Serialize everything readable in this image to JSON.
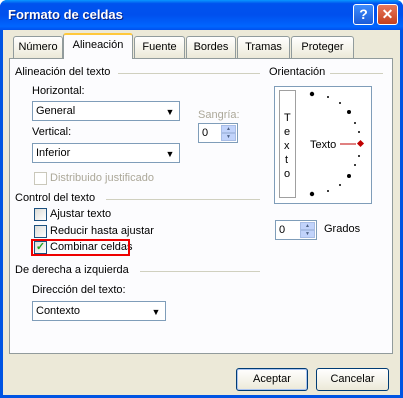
{
  "window": {
    "title": "Formato de celdas",
    "help_glyph": "?",
    "close_glyph": "✕"
  },
  "tabs": [
    {
      "label": "Número"
    },
    {
      "label": "Alineación",
      "active": true
    },
    {
      "label": "Fuente"
    },
    {
      "label": "Bordes"
    },
    {
      "label": "Tramas"
    },
    {
      "label": "Proteger"
    }
  ],
  "alignment": {
    "section_title": "Alineación del texto",
    "horizontal": {
      "label": "Horizontal:",
      "value": "General"
    },
    "vertical": {
      "label": "Vertical:",
      "value": "Inferior"
    },
    "indent": {
      "label": "Sangría:",
      "value": "0"
    },
    "distributed": {
      "label": "Distribuido justificado",
      "checked": false
    }
  },
  "text_control": {
    "section_title": "Control del texto",
    "wrap": {
      "label": "Ajustar texto",
      "checked": false
    },
    "shrink": {
      "label": "Reducir hasta ajustar",
      "checked": false
    },
    "merge": {
      "label": "Combinar celdas",
      "checked": true
    }
  },
  "rtl": {
    "section_title": "De derecha a izquierda",
    "direction": {
      "label": "Dirección del texto:",
      "value": "Contexto"
    }
  },
  "orientation": {
    "section_title": "Orientación",
    "vertical_text": [
      "T",
      "e",
      "x",
      "t",
      "o"
    ],
    "dial_text": "Texto",
    "degrees": {
      "value": "0",
      "label": "Grados"
    }
  },
  "buttons": {
    "ok": "Aceptar",
    "cancel": "Cancelar"
  },
  "colors": {
    "title_bar": "#0054e3",
    "highlight": "#e00000",
    "dial_marker": "#c00000"
  },
  "icons": {
    "dropdown": "▼",
    "spin_up": "▲",
    "spin_down": "▼",
    "checkmark": "✓"
  }
}
